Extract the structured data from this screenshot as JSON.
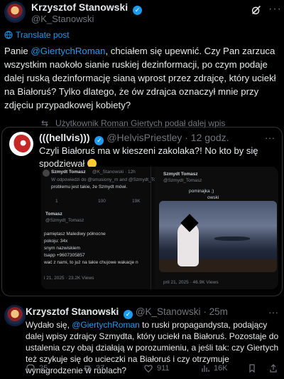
{
  "post": {
    "author_name": "Krzysztof Stanowski",
    "author_handle": "@K_Stanowski",
    "translate_label": "Translate post",
    "text_parts": [
      "Panie ",
      "@GiertychRoman",
      ", chciałem się upewnić. Czy Pan zarzuca wszystkim naokoło sianie ruskiej dezinformacji, po czym podaje dalej ruską dezinformację sianą wprost przez zdrajcę, który uciekł na Białoruś? Tylko dlatego, że ów zdrajca oznaczył mnie przy zdjęciu przypadkowej kobiety?"
    ]
  },
  "retweet_notice": "Użytkownik Roman Giertych podał dalej wpis",
  "quoted": {
    "display_name": "(((hellvis)))",
    "handle": "@HelvisPriestley",
    "time": "· 12 godz.",
    "text": "Czyli Białoruś ma w kieszeni zakolaka?! No kto by się spodziewał"
  },
  "screenshot": {
    "left_header_name": "Szmydt Tomasz",
    "left_header_handle": "@K_Stanowski · 12h",
    "left_reply_to": "W odpowiedzi do @smusiony_m and @Szmydt_Tomasz",
    "left_line": "problemu jest takie, że Szmydt mówi.",
    "left_counts": [
      "1",
      "100",
      "19K"
    ],
    "left_name2": "Tomasz",
    "left_handle2": "@Szmydt_Tomasz",
    "left_lines": [
      "pamiętasz Malediwy północne",
      "pokoju: 34x",
      "snym nazwiskiem",
      "tsapp +9607305857",
      "wać z nami, to już na takie chujowe wakacje n"
    ],
    "left_date": "l 21, 2025 · 23.2K Views",
    "right_name": "Szmydt Tomasz",
    "right_handle": "@Szmydt_Tomasz",
    "right_line": "pominajka ;)",
    "right_line2": "owski",
    "right_date": "pril 21, 2025 · 46.9K Views"
  },
  "reply": {
    "author_name": "Krzysztof Stanowski",
    "author_handle": "@K_Stanowski",
    "time": "· 25m",
    "text_parts": [
      "Wydało się, ",
      "@GiertychRoman",
      " to ruski propagandysta, podający dalej wpisy zdrajcy Szmydta, który uciekł na Białoruś. Pozostaje do ustalenia czy obaj działają w porozumieniu, a jeśli tak: czy Giertych też szykuje się do ucieczki na Białoruś i czy otrzymuje wynagrodzenie w rublach?"
    ]
  },
  "actions": {
    "replies": "25",
    "reposts": "37",
    "likes": "911",
    "views": "16K"
  },
  "colors": {
    "accent": "#1d9bf0",
    "muted": "#71767b",
    "text": "#e7e9ea",
    "background": "#000000"
  }
}
